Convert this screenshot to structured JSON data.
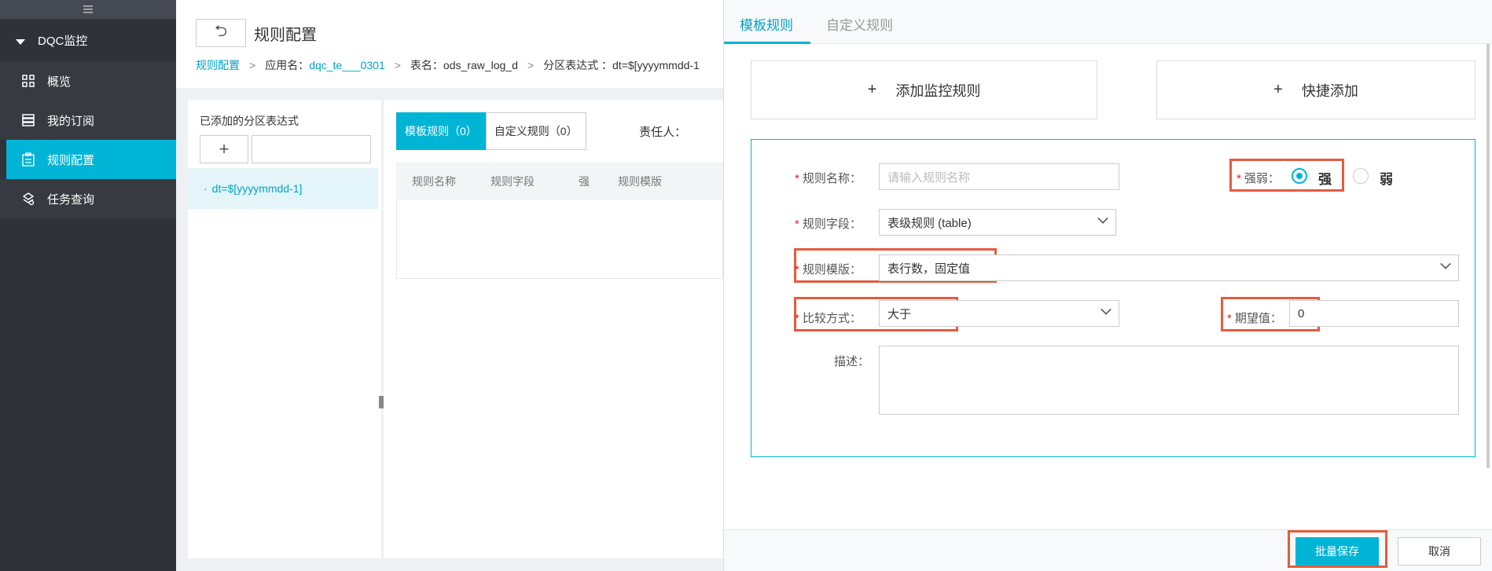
{
  "sidebar": {
    "group_label": "DQC监控",
    "items": [
      {
        "label": "概览",
        "icon": "grid-icon"
      },
      {
        "label": "我的订阅",
        "icon": "database-icon"
      },
      {
        "label": "规则配置",
        "icon": "clipboard-icon",
        "active": true
      },
      {
        "label": "任务查询",
        "icon": "search-task-icon"
      }
    ]
  },
  "header": {
    "back_symbol": "⮌",
    "title": "规则配置",
    "breadcrumb": {
      "root": "规则配置",
      "app_label": "应用名：",
      "app_value": "dqc_te___0301",
      "table_label": "表名：",
      "table_value": "ods_raw_log_d",
      "partition_label": "分区表达式 ：",
      "partition_value": "dt=$[yyyymmdd-1"
    }
  },
  "left_panel": {
    "header": "已添加的分区表达式",
    "add_symbol": "+",
    "partition_item": "dt=$[yyyymmdd-1]"
  },
  "right_panel": {
    "tabs": [
      "模板规则（0）",
      "自定义规则（0）"
    ],
    "owner_label": "责任人：",
    "columns": [
      "规则名称",
      "规则字段",
      "强",
      "规则模版"
    ]
  },
  "drawer": {
    "tabs": [
      "模板规则",
      "自定义规则"
    ],
    "add_rule_button": "添加监控规则",
    "quick_add_button": "快捷添加",
    "plus_symbol": "+",
    "form": {
      "rule_name_label": "规则名称：",
      "rule_name_placeholder": "请输入规则名称",
      "strength_label": "强弱：",
      "strength_options": [
        "强",
        "弱"
      ],
      "strength_selected": "强",
      "rule_field_label": "规则字段：",
      "rule_field_value": "表级规则 (table)",
      "rule_template_label": "规则模版：",
      "rule_template_value": "表行数，固定值",
      "compare_label": "比较方式：",
      "compare_value": "大于",
      "expected_label": "期望值：",
      "expected_value": "0",
      "desc_label": "描述："
    },
    "save_button": "批量保存",
    "cancel_button": "取消"
  },
  "colors": {
    "accent": "#00b4d6",
    "highlight": "#e65b3d",
    "sidebar_bg": "#2f3238"
  }
}
